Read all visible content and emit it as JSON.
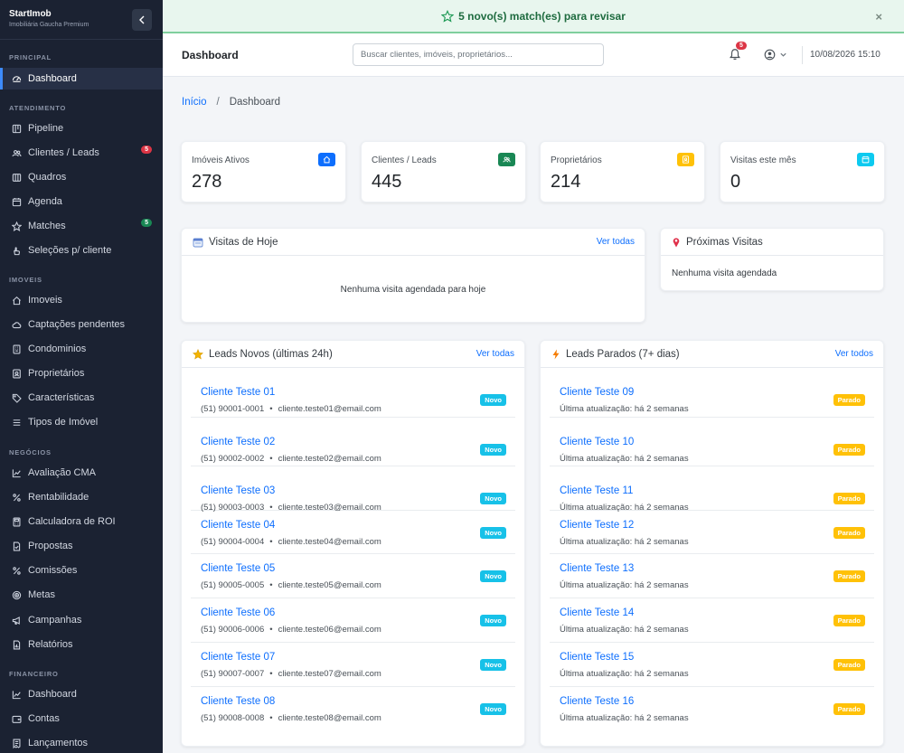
{
  "brand": {
    "name": "StartImob",
    "subtitle": "Imobiliária Gaucha Premium"
  },
  "colors": {
    "sidebar": "#1b2232",
    "primary": "#0d6efd",
    "success": "#198754",
    "warning": "#ffc107",
    "info": "#0dcaf0",
    "danger": "#dc3545"
  },
  "sidebar": {
    "sections": [
      {
        "title": "PRINCIPAL",
        "items": [
          {
            "label": "Dashboard",
            "icon": "dashboard-icon",
            "active": true
          }
        ]
      },
      {
        "title": "ATENDIMENTO",
        "items": [
          {
            "label": "Pipeline",
            "icon": "kanban-icon"
          },
          {
            "label": "Clientes / Leads",
            "icon": "people-icon",
            "badge": "5",
            "badge_color": "#dc3545"
          },
          {
            "label": "Quadros",
            "icon": "columns-icon"
          },
          {
            "label": "Agenda",
            "icon": "calendar-icon"
          },
          {
            "label": "Matches",
            "icon": "star-icon",
            "badge": "5",
            "badge_color": "#198754"
          },
          {
            "label": "Seleções p/ cliente",
            "icon": "hand-icon"
          }
        ]
      },
      {
        "title": "IMOVEIS",
        "items": [
          {
            "label": "Imoveis",
            "icon": "house-icon"
          },
          {
            "label": "Captações pendentes",
            "icon": "cloud-icon"
          },
          {
            "label": "Condominios",
            "icon": "building-icon"
          },
          {
            "label": "Proprietários",
            "icon": "person-badge-icon"
          },
          {
            "label": "Características",
            "icon": "tag-icon"
          },
          {
            "label": "Tipos de Imóvel",
            "icon": "list-icon"
          }
        ]
      },
      {
        "title": "NEGÓCIOS",
        "items": [
          {
            "label": "Avaliação CMA",
            "icon": "graph-icon"
          },
          {
            "label": "Rentabilidade",
            "icon": "percent-icon"
          },
          {
            "label": "Calculadora de ROI",
            "icon": "calculator-icon"
          },
          {
            "label": "Propostas",
            "icon": "file-check-icon"
          },
          {
            "label": "Comissões",
            "icon": "percent-icon"
          },
          {
            "label": "Metas",
            "icon": "target-icon"
          },
          {
            "label": "Campanhas",
            "icon": "megaphone-icon"
          },
          {
            "label": "Relatórios",
            "icon": "report-icon"
          }
        ]
      },
      {
        "title": "FINANCEIRO",
        "items": [
          {
            "label": "Dashboard",
            "icon": "graph-icon"
          },
          {
            "label": "Contas",
            "icon": "wallet-icon"
          },
          {
            "label": "Lançamentos",
            "icon": "receipt-icon"
          }
        ]
      }
    ]
  },
  "banner": {
    "text": "5 novo(s) match(es) para revisar",
    "close": "×"
  },
  "header": {
    "title": "Dashboard",
    "search_placeholder": "Buscar clientes, imóveis, proprietários...",
    "notifications": "5",
    "datetime": "10/08/2026 15:10"
  },
  "breadcrumb": {
    "home": "Início",
    "sep": "/",
    "current": "Dashboard"
  },
  "stats": [
    {
      "label": "Imóveis Ativos",
      "value": "278",
      "icon": "house-icon",
      "color": "#0d6efd"
    },
    {
      "label": "Clientes / Leads",
      "value": "445",
      "icon": "people-icon",
      "color": "#198754"
    },
    {
      "label": "Proprietários",
      "value": "214",
      "icon": "person-badge-icon",
      "color": "#ffc107"
    },
    {
      "label": "Visitas este mês",
      "value": "0",
      "icon": "calendar-icon",
      "color": "#0dcaf0"
    }
  ],
  "visits_today": {
    "title": "Visitas de Hoje",
    "link": "Ver todas",
    "empty": "Nenhuma visita agendada para hoje"
  },
  "next_visits": {
    "title": "Próximas Visitas",
    "empty": "Nenhuma visita agendada"
  },
  "new_leads": {
    "title": "Leads Novos (últimas 24h)",
    "link": "Ver todas",
    "items": [
      {
        "name": "Cliente Teste 01",
        "phone": "(51) 90001-0001",
        "email": "cliente.teste01@email.com",
        "status": "Novo"
      },
      {
        "name": "Cliente Teste 02",
        "phone": "(51) 90002-0002",
        "email": "cliente.teste02@email.com",
        "status": "Novo"
      },
      {
        "name": "Cliente Teste 03",
        "phone": "(51) 90003-0003",
        "email": "cliente.teste03@email.com",
        "status": "Novo"
      },
      {
        "name": "Cliente Teste 04",
        "phone": "(51) 90004-0004",
        "email": "cliente.teste04@email.com",
        "status": "Novo"
      },
      {
        "name": "Cliente Teste 05",
        "phone": "(51) 90005-0005",
        "email": "cliente.teste05@email.com",
        "status": "Novo"
      },
      {
        "name": "Cliente Teste 06",
        "phone": "(51) 90006-0006",
        "email": "cliente.teste06@email.com",
        "status": "Novo"
      },
      {
        "name": "Cliente Teste 07",
        "phone": "(51) 90007-0007",
        "email": "cliente.teste07@email.com",
        "status": "Novo"
      },
      {
        "name": "Cliente Teste 08",
        "phone": "(51) 90008-0008",
        "email": "cliente.teste08@email.com",
        "status": "Novo"
      }
    ]
  },
  "stale_leads": {
    "title": "Leads Parados (7+ dias)",
    "link": "Ver todos",
    "items": [
      {
        "name": "Cliente Teste 09",
        "detail": "Última atualização: há 2 semanas",
        "status": "Parado"
      },
      {
        "name": "Cliente Teste 10",
        "detail": "Última atualização: há 2 semanas",
        "status": "Parado"
      },
      {
        "name": "Cliente Teste 11",
        "detail": "Última atualização: há 2 semanas",
        "status": "Parado"
      },
      {
        "name": "Cliente Teste 12",
        "detail": "Última atualização: há 2 semanas",
        "status": "Parado"
      },
      {
        "name": "Cliente Teste 13",
        "detail": "Última atualização: há 2 semanas",
        "status": "Parado"
      },
      {
        "name": "Cliente Teste 14",
        "detail": "Última atualização: há 2 semanas",
        "status": "Parado"
      },
      {
        "name": "Cliente Teste 15",
        "detail": "Última atualização: há 2 semanas",
        "status": "Parado"
      },
      {
        "name": "Cliente Teste 16",
        "detail": "Última atualização: há 2 semanas",
        "status": "Parado"
      }
    ]
  }
}
